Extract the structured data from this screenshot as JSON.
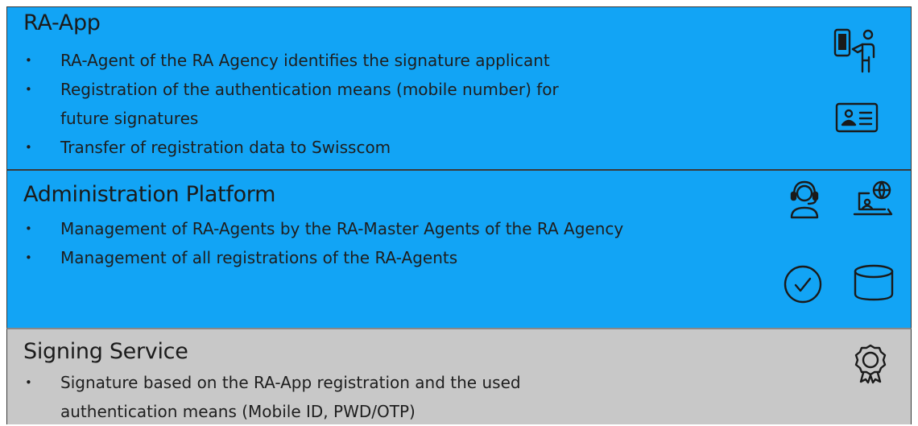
{
  "sections": [
    {
      "title": "RA-App",
      "bullets": [
        {
          "text": "RA-Agent of the RA Agency identifies the signature applicant"
        },
        {
          "text": "Registration of the authentication means (mobile number) for",
          "cont": "future signatures"
        },
        {
          "text": "Transfer of registration data to Swisscom"
        }
      ],
      "icons": [
        "mobile-agent-icon",
        "id-card-icon"
      ],
      "color": "#12a4f5"
    },
    {
      "title": "Administration Platform",
      "bullets": [
        {
          "text": "Management of RA-Agents by the RA-Master Agents of the RA Agency"
        },
        {
          "text": "Management of all registrations of the RA-Agents"
        }
      ],
      "icons": [
        "support-agent-icon",
        "web-laptop-icon",
        "check-circle-icon",
        "database-icon"
      ],
      "color": "#12a4f5"
    },
    {
      "title": "Signing Service",
      "bullets": [
        {
          "text": "Signature based on the RA-App registration and the used",
          "cont": "authentication means (Mobile ID, PWD/OTP)"
        }
      ],
      "icons": [
        "certificate-badge-icon"
      ],
      "color": "#c8c8c8"
    }
  ],
  "bullet_symbol": "•"
}
